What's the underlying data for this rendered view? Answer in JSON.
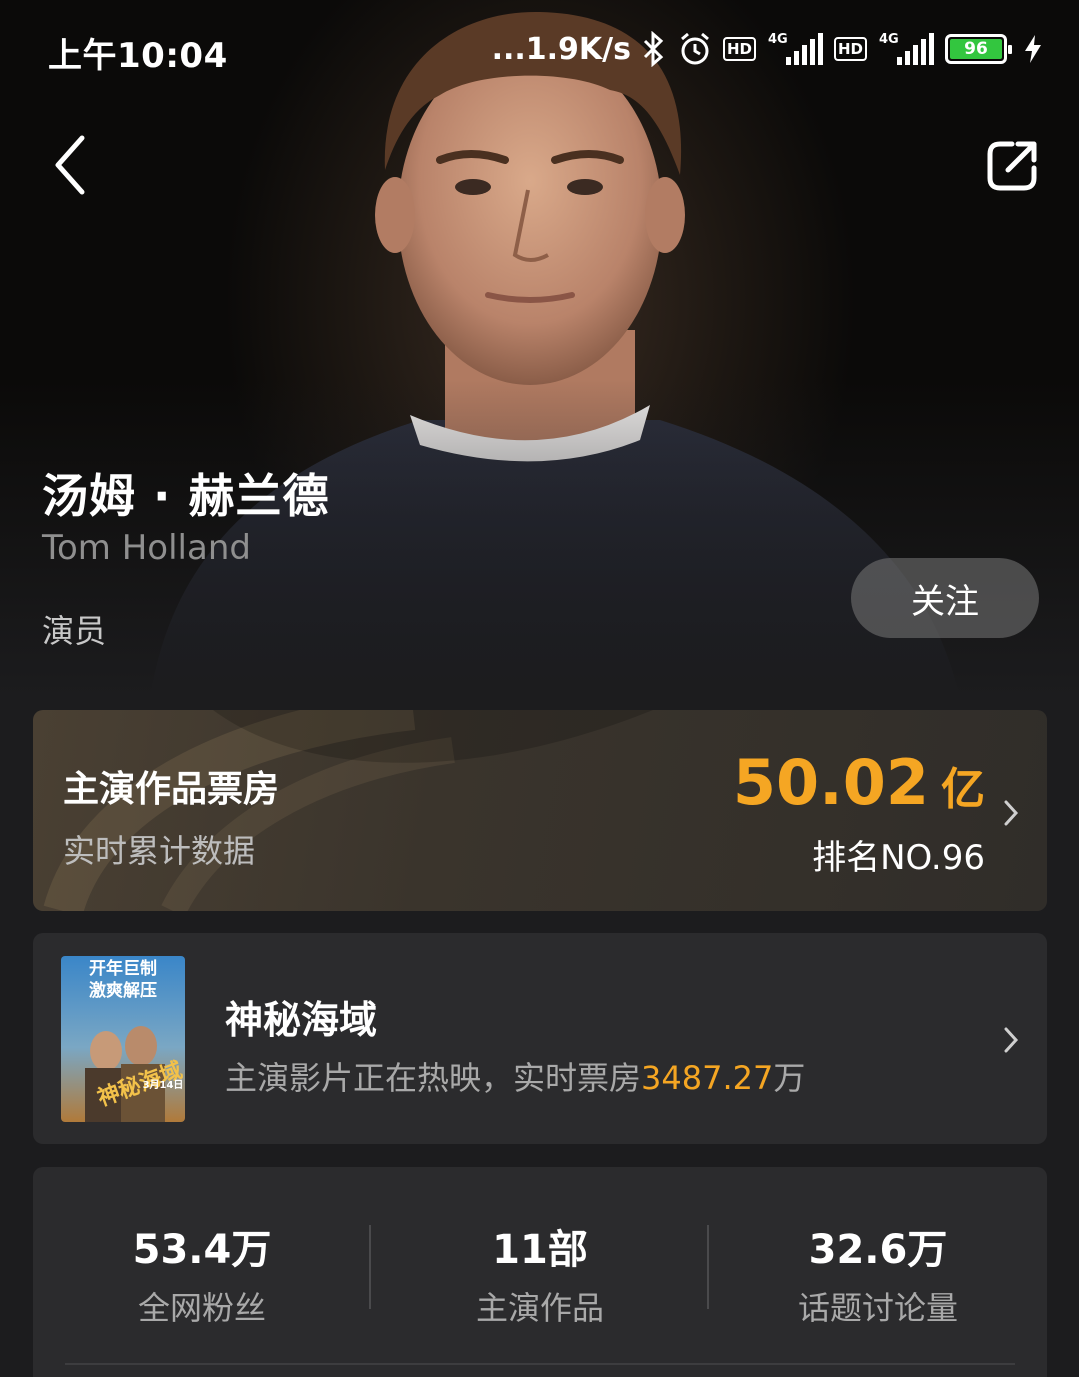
{
  "status_bar": {
    "time": "上午10:04",
    "net_speed": "...1.9K/s",
    "hd_label_1": "HD",
    "hd_label_2": "HD",
    "network_1": "4G",
    "network_2": "4G",
    "battery_level": "96",
    "battery_color": "#33c63f"
  },
  "header": {
    "back_icon": "chevron-left-icon",
    "share_icon": "share-icon"
  },
  "actor": {
    "name_cn": "汤姆 · 赫兰德",
    "name_en": "Tom Holland",
    "role": "演员",
    "follow_label": "关注"
  },
  "box_office": {
    "title": "主演作品票房",
    "subtitle": "实时累计数据",
    "value": "50.02",
    "unit": "亿",
    "rank": "排名NO.96",
    "accent_color": "#f5a623"
  },
  "now_showing": {
    "poster_banner_1": "开年巨制",
    "poster_banner_2": "激爽解压",
    "poster_date": "3月14日",
    "title": "神秘海域",
    "desc_prefix": "主演影片正在热映，实时票房",
    "desc_value": "3487.27",
    "desc_suffix": "万"
  },
  "stats": [
    {
      "value": "53.4万",
      "label": "全网粉丝"
    },
    {
      "value": "11部",
      "label": "主演作品"
    },
    {
      "value": "32.6万",
      "label": "话题讨论量"
    }
  ]
}
